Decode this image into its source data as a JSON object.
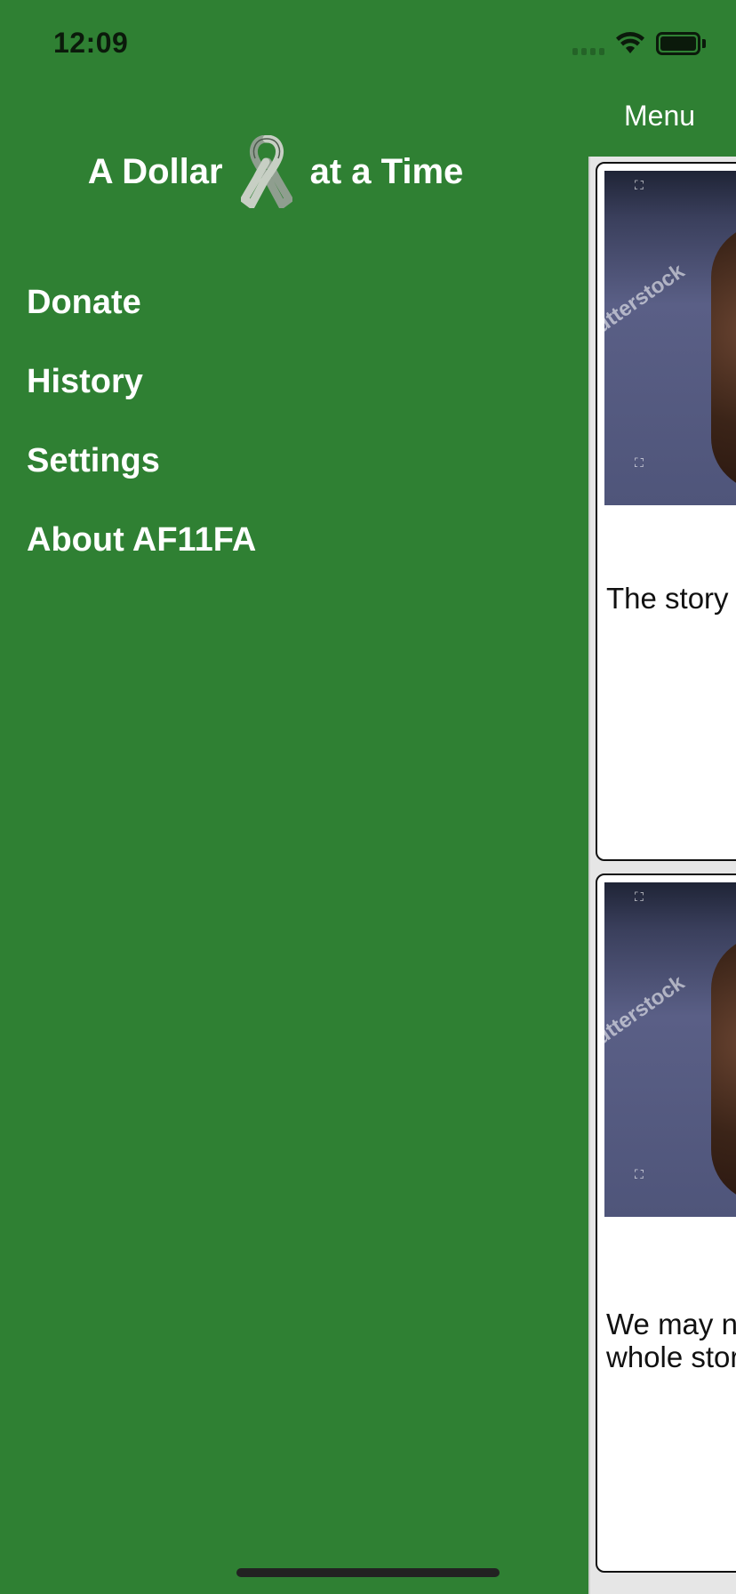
{
  "status_bar": {
    "time": "12:09"
  },
  "side_menu": {
    "header": {
      "title_left": "A Dollar",
      "title_right": "at a Time",
      "logo_icon": "awareness-ribbon-icon"
    },
    "items": [
      {
        "label": "Donate"
      },
      {
        "label": "History"
      },
      {
        "label": "Settings"
      },
      {
        "label": "About AF11FA"
      }
    ]
  },
  "main": {
    "menu_button_label": "Menu",
    "cards": [
      {
        "text": "The story",
        "image_watermark": "utterstock"
      },
      {
        "text": "We may n\nwhole stor",
        "image_watermark": "utterstock"
      }
    ]
  },
  "colors": {
    "menu_background": "#2f8033",
    "menu_text": "#ffffff",
    "card_background": "#ffffff"
  }
}
